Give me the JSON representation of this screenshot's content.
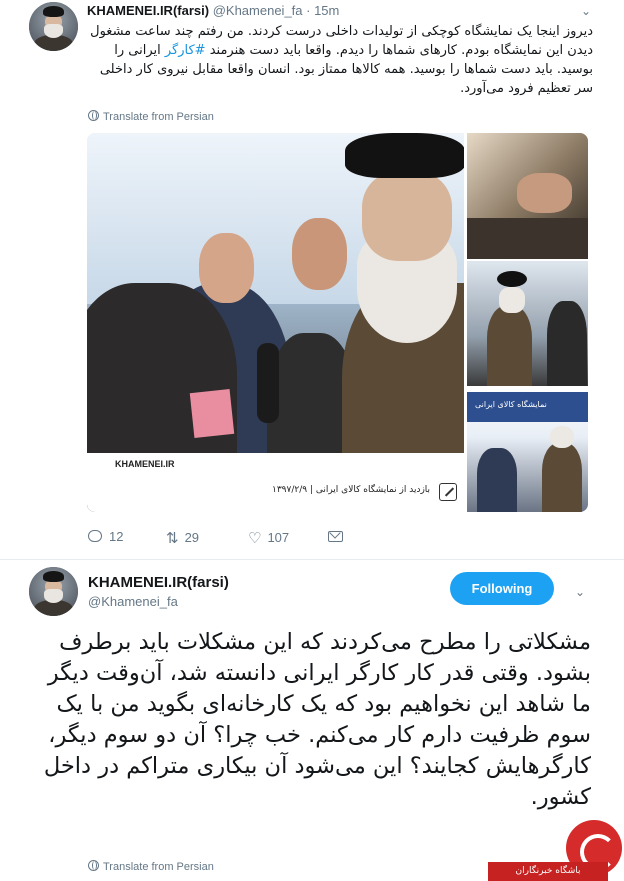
{
  "tweet1": {
    "display_name": "KHAMENEI.IR(farsi)",
    "handle": "@Khamenei_fa",
    "time": "· 15m",
    "text_before_hashtag": "دیروز اینجا یک نمایشگاه کوچکی از تولیدات داخلی درست کردند. من رفتم چند ساعت مشغول دیدن این نمایشگاه بودم. کارهای شماها را دیدم. واقعا باید دست هنرمند ",
    "hashtag": "#کارگر",
    "text_after_hashtag": " ایرانی را بوسید. باید دست شماها را بوسید. همه کالاها ممتاز بود. انسان واقعا مقابل نیروی کار داخلی سر تعظیم فرود می‌آورد.",
    "translate_label": "Translate from Persian",
    "image": {
      "logo_text": "KHAMENEI.IR",
      "caption": "بازدید از نمایشگاه کالای ایرانی | ۱۳۹۷/۲/۹",
      "banner_text": "نمایشگاه کالای ایرانی"
    },
    "actions": {
      "reply_count": "12",
      "retweet_count": "29",
      "like_count": "107"
    },
    "icons": {
      "reply": "reply-icon",
      "retweet": "retweet-icon",
      "like": "heart-icon",
      "dm": "envelope-icon",
      "more": "chevron-down-icon"
    }
  },
  "tweet2": {
    "display_name": "KHAMENEI.IR(farsi)",
    "handle": "@Khamenei_fa",
    "follow_label": "Following",
    "text": "مشکلاتی را مطرح می‌کردند که این مشکلات باید برطرف بشود. وقتی قدر کار کارگر ایرانی دانسته شد، آن‌وقت دیگر ما شاهد این نخواهیم بود که یک کارخانه‌ای بگوید من با یک سوم ظرفیت دارم کار می‌کنم. خب چرا؟ آن دو سوم دیگر، کارگرهایش کجایند؟ این می‌شود آن بیکاری متراکم در داخل کشور.",
    "translate_label": "Translate from Persian"
  },
  "watermark": {
    "text": "باشگاه خبرنگاران"
  },
  "colors": {
    "accent": "#1da1f2",
    "link": "#1b95e0",
    "muted": "#657786",
    "text": "#14171a",
    "watermark": "#c62222"
  }
}
